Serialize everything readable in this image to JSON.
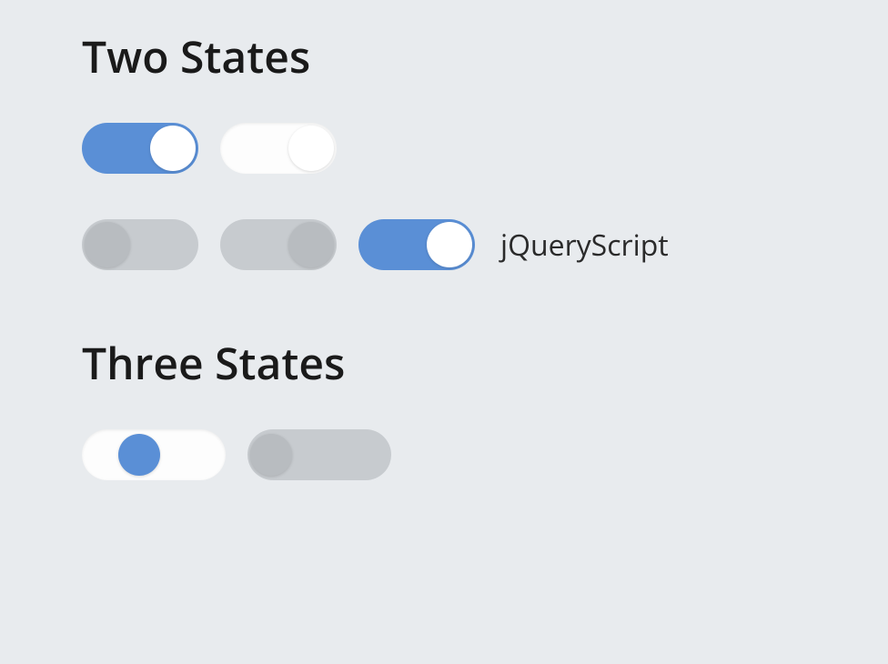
{
  "sections": {
    "two_states": {
      "heading": "Two States",
      "row1": {
        "toggles": [
          {
            "state": "on",
            "bg": "blue",
            "thumb_pos": "right",
            "thumb_color": "white"
          },
          {
            "state": "off",
            "bg": "white",
            "thumb_pos": "right",
            "thumb_color": "white"
          }
        ]
      },
      "row2": {
        "toggles": [
          {
            "state": "off",
            "bg": "gray",
            "thumb_pos": "left",
            "thumb_color": "gray"
          },
          {
            "state": "off",
            "bg": "gray",
            "thumb_pos": "right",
            "thumb_color": "gray"
          },
          {
            "state": "on",
            "bg": "blue",
            "thumb_pos": "right",
            "thumb_color": "white"
          }
        ],
        "label": "jQueryScript"
      }
    },
    "three_states": {
      "heading": "Three States",
      "row1": {
        "toggles": [
          {
            "state": "middle",
            "bg": "white",
            "thumb_pos": "center",
            "thumb_color": "blue"
          },
          {
            "state": "off",
            "bg": "gray",
            "thumb_pos": "left",
            "thumb_color": "gray"
          }
        ]
      }
    }
  },
  "colors": {
    "accent_blue": "#5a8fd6",
    "gray_track": "#c7cbcf",
    "gray_thumb": "#b8bcc0",
    "white": "#ffffff",
    "background": "#e8ebee"
  }
}
